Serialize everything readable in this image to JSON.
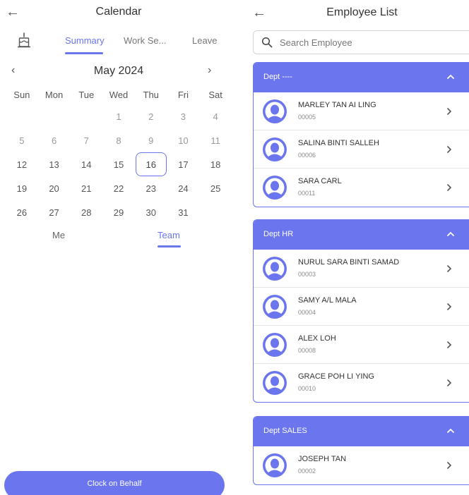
{
  "calendar": {
    "title": "Calendar",
    "tabs": {
      "summary": "Summary",
      "work": "Work Se...",
      "leave": "Leave"
    },
    "month": "May 2024",
    "prev_symbol": "‹",
    "next_symbol": "›",
    "weekdays": [
      "Sun",
      "Mon",
      "Tue",
      "Wed",
      "Thu",
      "Fri",
      "Sat"
    ],
    "leading_blanks": 3,
    "days_in_month": 31,
    "selected_day": 16,
    "view": {
      "me": "Me",
      "team": "Team",
      "active": "Team"
    },
    "clock_button": "Clock on Behalf",
    "accent": "#6a75ee"
  },
  "employees": {
    "title": "Employee List",
    "search_placeholder": "Search Employee",
    "departments": [
      {
        "name": "Dept ----",
        "members": [
          {
            "name": "MARLEY TAN AI LING",
            "id": "00005"
          },
          {
            "name": "SALINA BINTI SALLEH",
            "id": "00006"
          },
          {
            "name": "SARA CARL",
            "id": "00011"
          }
        ]
      },
      {
        "name": "Dept HR",
        "members": [
          {
            "name": "NURUL SARA BINTI SAMAD",
            "id": "00003"
          },
          {
            "name": "SAMY A/L MALA",
            "id": "00004"
          },
          {
            "name": "ALEX LOH",
            "id": "00008"
          },
          {
            "name": "GRACE POH LI YING",
            "id": "00010"
          }
        ]
      },
      {
        "name": "Dept SALES",
        "members": [
          {
            "name": "JOSEPH TAN",
            "id": "00002"
          }
        ]
      }
    ]
  },
  "icons": {
    "back": "back-arrow-icon",
    "cake": "cake-icon",
    "search": "search-icon",
    "collapse": "chevron-up-icon",
    "row": "chevron-right-icon",
    "avatar": "avatar-icon"
  }
}
